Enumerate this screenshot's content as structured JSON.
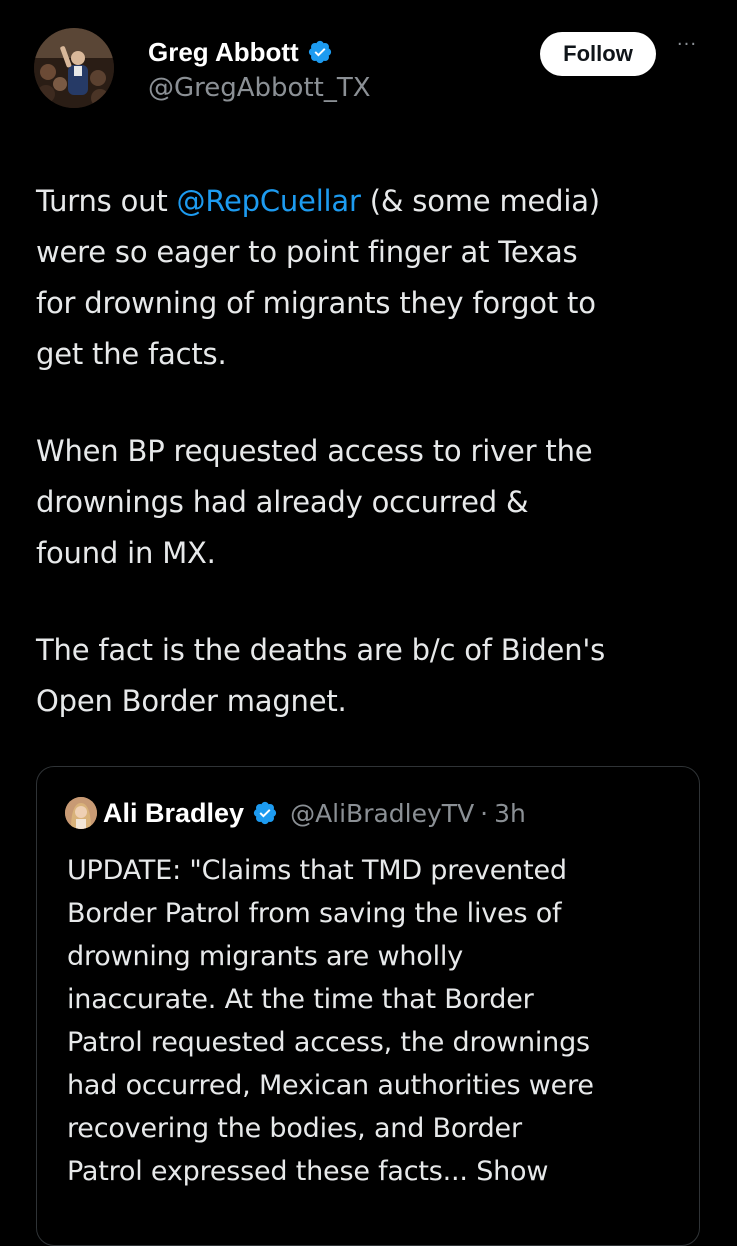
{
  "author": {
    "display_name": "Greg Abbott",
    "handle": "@GregAbbott_TX",
    "verified_icon": "verified-badge-icon",
    "avatar_icon": "profile-photo"
  },
  "actions": {
    "follow_label": "Follow",
    "more_icon": "more-options-icon",
    "more_glyph": "···"
  },
  "tweet": {
    "line1_prefix": "Turns out ",
    "mention": "@RepCuellar",
    "line1_suffix": " (& some media)\nwere so eager to point finger at Texas\nfor drowning of migrants they forgot to\nget the facts.",
    "paragraph2": "When BP requested access to river the\ndrownings had already occurred &\nfound in MX.",
    "paragraph3": "The fact is the deaths are b/c of Biden's\nOpen Border magnet."
  },
  "quote": {
    "display_name": "Ali Bradley",
    "handle": "@AliBradleyTV",
    "separator": "·",
    "time": "3h",
    "text": "UPDATE: \"Claims that TMD prevented\nBorder Patrol from saving the lives of\ndrowning migrants are wholly\ninaccurate. At the time that Border\nPatrol requested access, the drownings\nhad occurred, Mexican authorities were\nrecovering the bodies, and Border\nPatrol expressed these facts... ",
    "show_more": "Show"
  },
  "colors": {
    "background": "#000000",
    "text": "#e7e9ea",
    "secondary": "#8b9095",
    "link": "#1d9bf0",
    "verified": "#1d9bf0"
  }
}
